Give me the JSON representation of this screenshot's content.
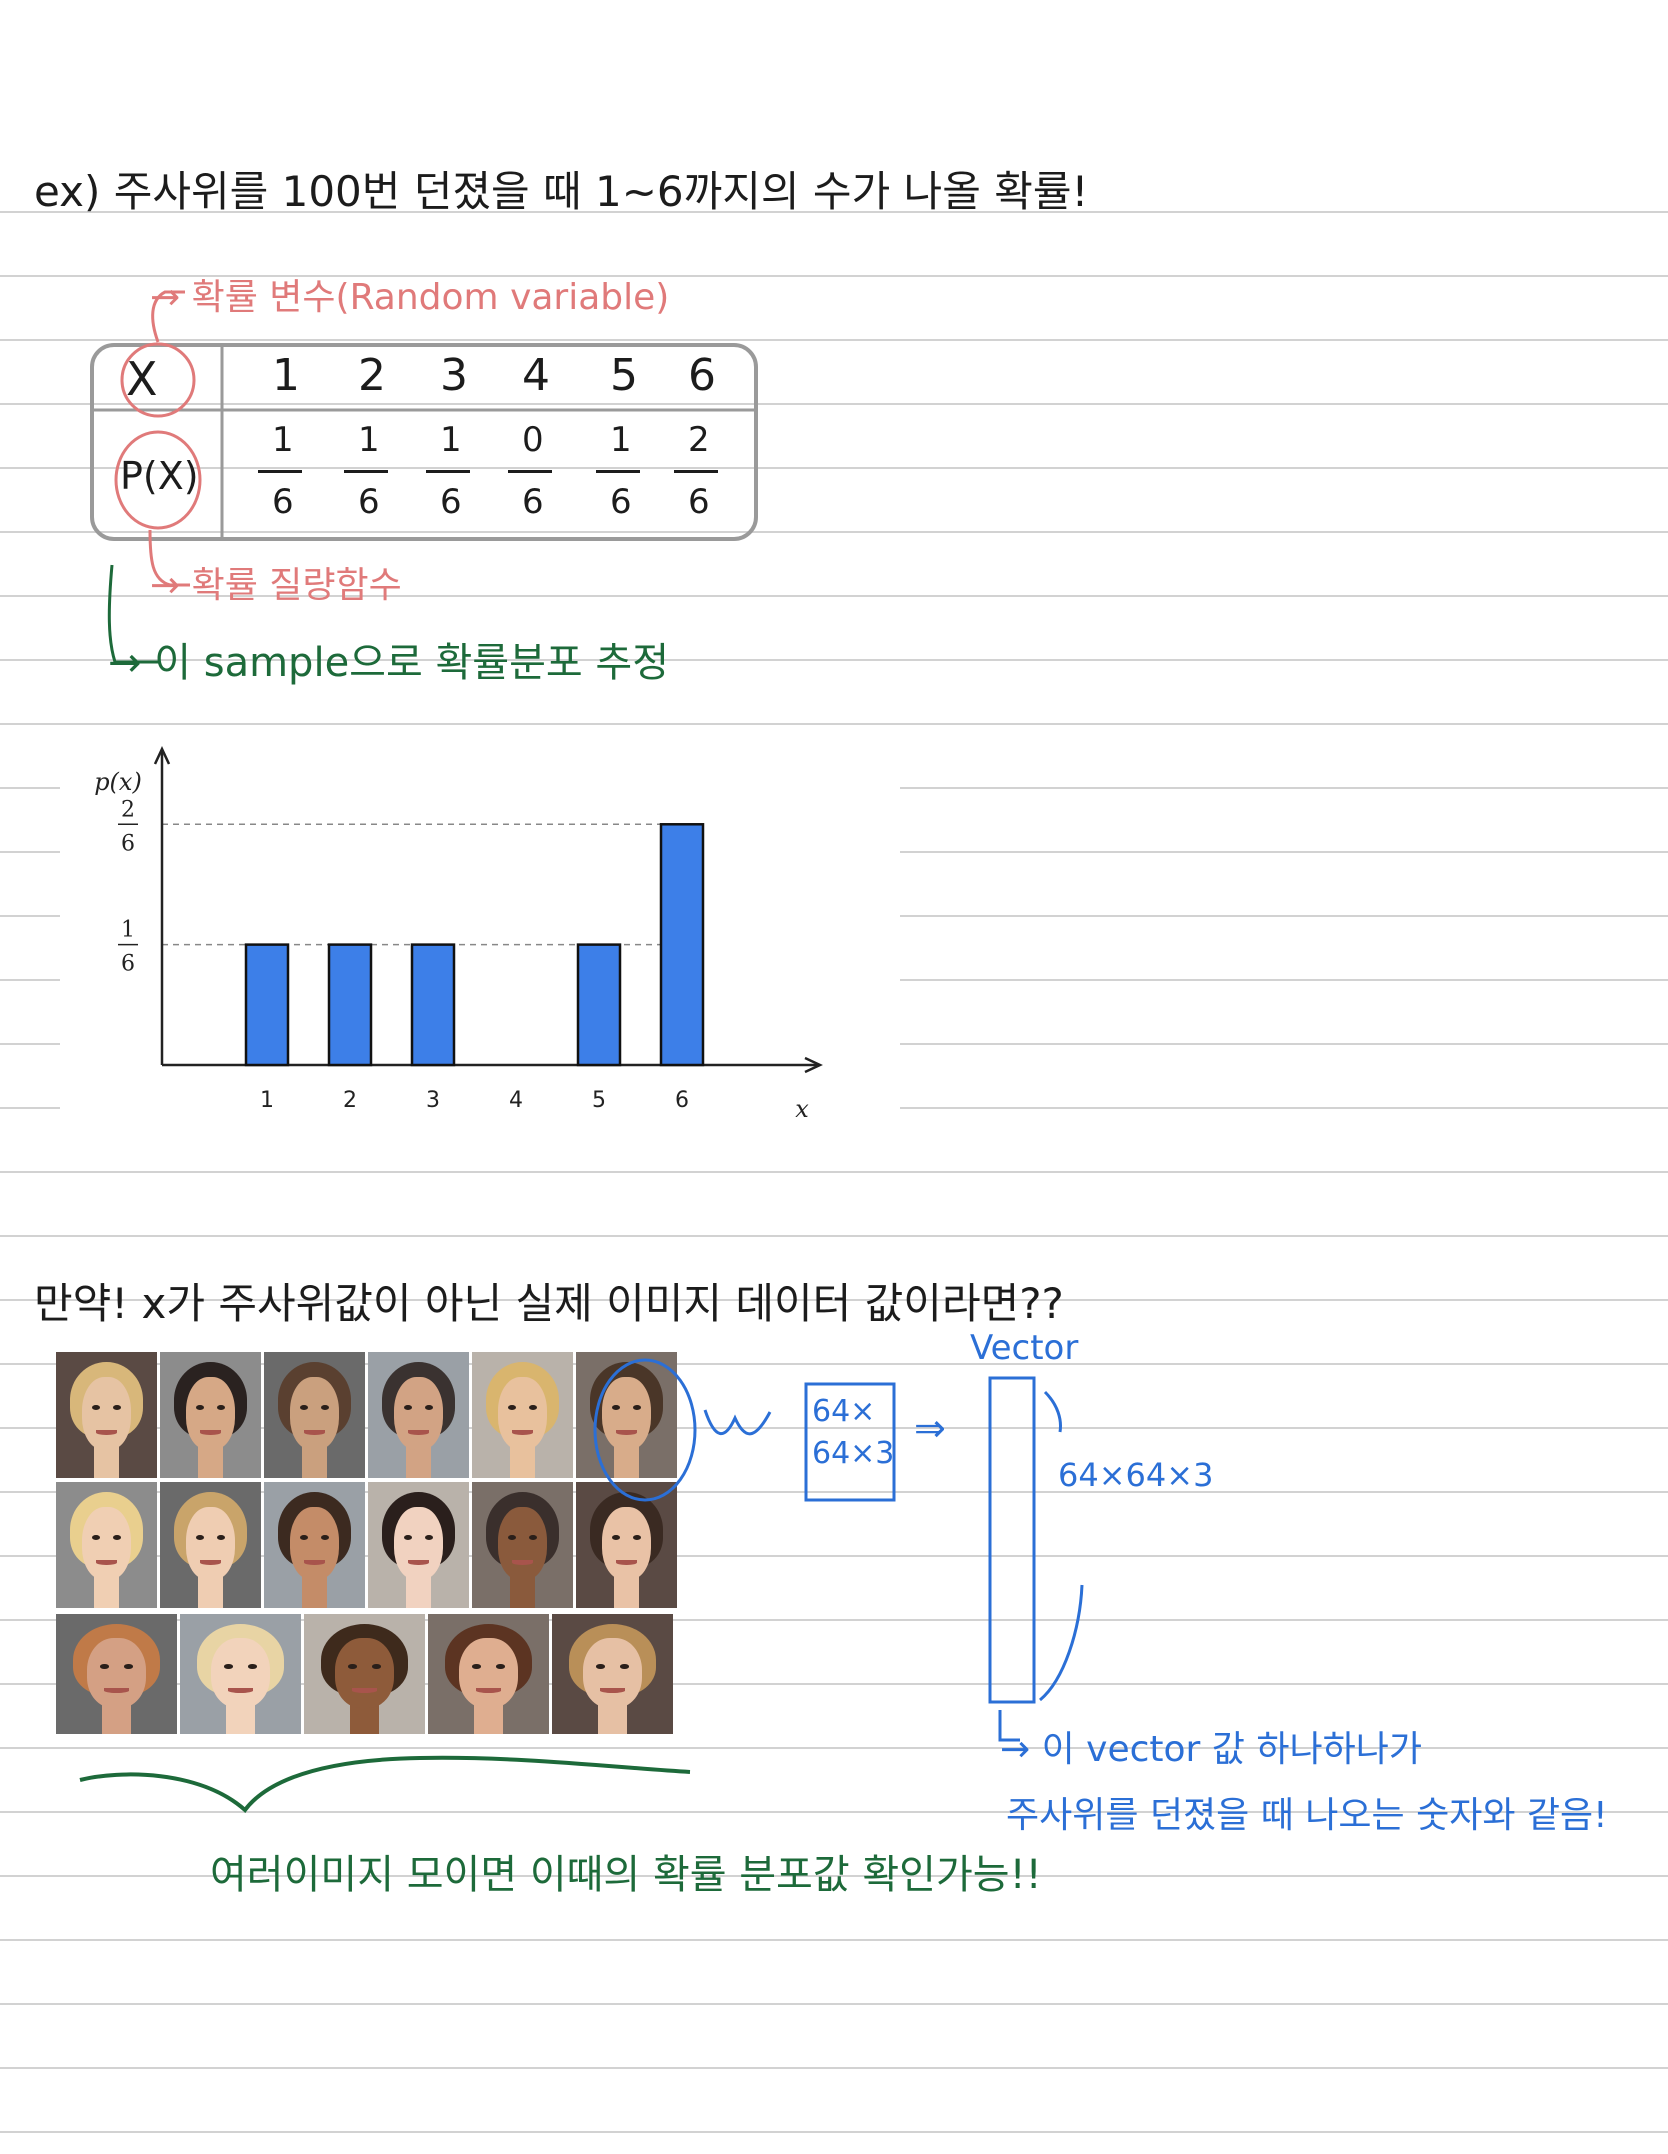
{
  "heading_example": "ex) 주사위를 100번 던졌을 때  1~6까지의 수가 나올 확률!",
  "random_variable_note": "→ 확률 변수(Random variable)",
  "table": {
    "row_x_label": "X",
    "row_p_label": "P(X)",
    "x_values": [
      "1",
      "2",
      "3",
      "4",
      "5",
      "6"
    ],
    "p_numerators": [
      "1",
      "1",
      "1",
      "0",
      "1",
      "2"
    ],
    "p_denominators": [
      "6",
      "6",
      "6",
      "6",
      "6",
      "6"
    ]
  },
  "pmf_note": "→ 확률 질량함수",
  "sample_note": "→ 이 sample으로  확률분포 추정",
  "chart_data": {
    "type": "bar",
    "categories": [
      "1",
      "2",
      "3",
      "4",
      "5",
      "6"
    ],
    "values": [
      0.1667,
      0.1667,
      0.1667,
      0,
      0.1667,
      0.3333
    ],
    "ylabel": "p(x)",
    "xlabel": "x",
    "ylim": [
      0,
      0.45
    ],
    "y_tick_labels": [
      {
        "value": 0.1667,
        "num": "1",
        "den": "6"
      },
      {
        "value": 0.3333,
        "num": "2",
        "den": "6"
      }
    ],
    "reference_lines": [
      0.1667,
      0.3333
    ],
    "bar_color": "#3d7fe8"
  },
  "heading_image": "만약!  x가 주사위값이 아닌  실제 이미지 데이터 값이라면??",
  "face_grid": {
    "rows": [
      [
        "#e6c3a3",
        "#d6a886",
        "#caa07e",
        "#d2a384",
        "#e8c19d",
        "#d8ac8a"
      ],
      [
        "#f0cfb3",
        "#efcdb2",
        "#c48c68",
        "#f1d2c0",
        "#8a5a3c",
        "#e9c2a6"
      ],
      [
        "#d4a084",
        "#f2d3bb",
        "#8e5b3a",
        "#dfae90",
        "#e6c0a4"
      ]
    ],
    "hair": [
      [
        "#d8b77a",
        "#2a2220",
        "#5a4030",
        "#3a3230",
        "#d9b56e",
        "#4a3628"
      ],
      [
        "#e9cf8e",
        "#c9a46a",
        "#3c2a20",
        "#2a1f1c",
        "#3a2f2c",
        "#3a2a22"
      ],
      [
        "#c07a48",
        "#e8d4a4",
        "#3e2a1c",
        "#5c3422",
        "#b98f58"
      ]
    ]
  },
  "arrow_label": "~>",
  "box_label_line1": "64×",
  "box_label_line2": "64×3",
  "implies": "⇒",
  "vector_label": "Vector",
  "vector_dim": "64×64×3",
  "vector_note_line1": "→ 이 vector 값 하나하나가",
  "vector_note_line2": "주사위를 던졌을 때 나오는 숫자와 같음!",
  "brace_note": "여러이미지 모이면 이때의 확률 분포값 확인가능!!"
}
